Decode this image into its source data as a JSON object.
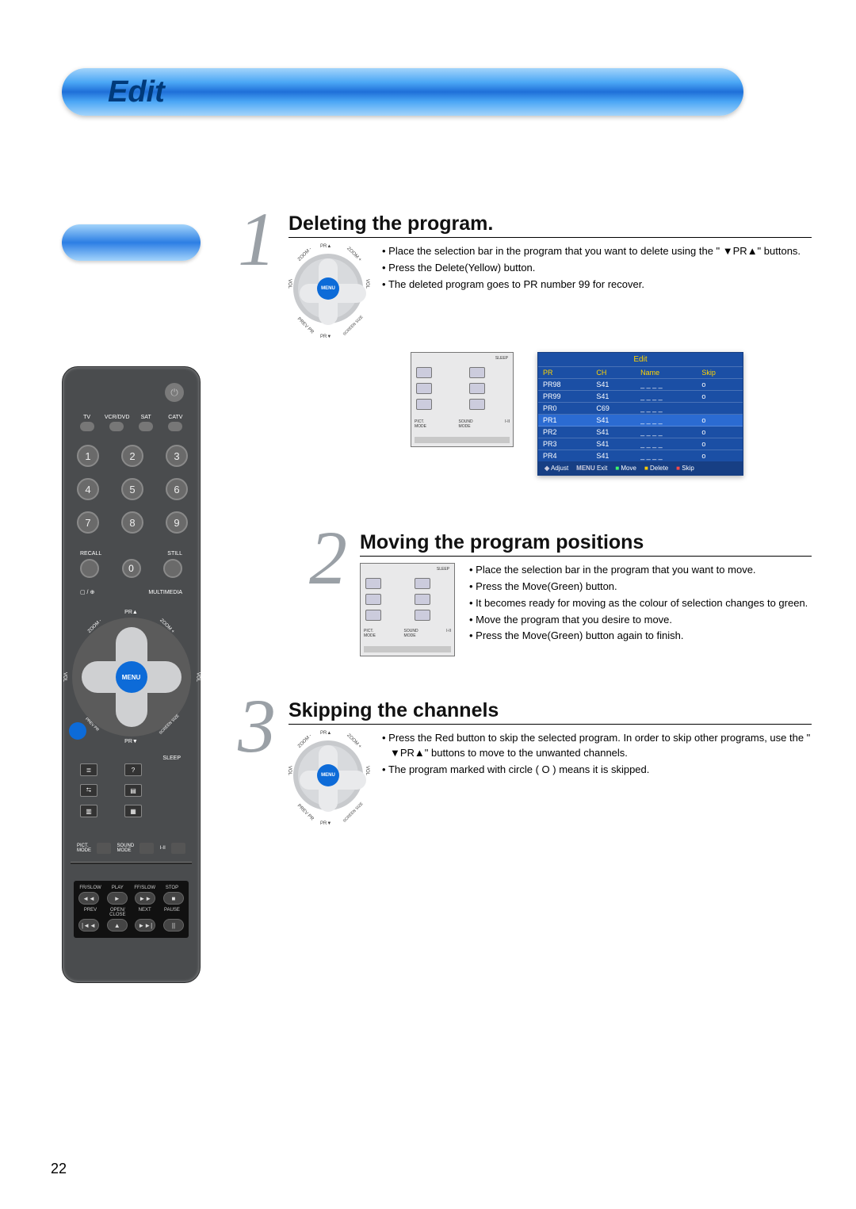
{
  "page_title": "Edit",
  "page_number": "22",
  "remote": {
    "sources": [
      "TV",
      "VCR/DVD",
      "SAT",
      "CATV"
    ],
    "numbers": [
      "1",
      "2",
      "3",
      "4",
      "5",
      "6",
      "7",
      "8",
      "9",
      "0"
    ],
    "recall": "RECALL",
    "still": "STILL",
    "multimedia": "MULTIMEDIA",
    "tv_av": "▢ / ⊕",
    "dpad": {
      "menu": "MENU",
      "pr_up": "PR▲",
      "pr_dn": "PR▼",
      "vol": "VOL",
      "zoom_minus": "ZOOM -",
      "zoom_plus": "ZOOM +",
      "prev_pr": "PREV PR",
      "screen_size": "SCREEN SIZE"
    },
    "sleep": "SLEEP",
    "modes": {
      "pict": "PICT.\nMODE",
      "sound": "SOUND\nMODE",
      "i_ii": "I-II"
    },
    "transport_labels_row1": [
      "FR/SLOW",
      "PLAY",
      "FF/SLOW",
      "STOP"
    ],
    "transport_labels_row2": [
      "PREV",
      "OPEN/\nCLOSE",
      "NEXT",
      "PAUSE"
    ],
    "transport_icons_row1": [
      "◄◄",
      "►",
      "►►",
      "■"
    ],
    "transport_icons_row2": [
      "|◄◄",
      "▲",
      "►►|",
      "||"
    ]
  },
  "steps": [
    {
      "num": "1",
      "title": "Deleting the program.",
      "bullets": [
        "Place the selection bar in the program that you want to delete using the \" ▼PR▲\" buttons.",
        "Press the Delete(Yellow) button.",
        "The deleted program goes to PR number 99 for recover."
      ]
    },
    {
      "num": "2",
      "title": "Moving the program positions",
      "bullets": [
        "Place the selection bar in the program that you want to move.",
        "Press the Move(Green) button.",
        "It becomes ready for moving as the colour of selection changes to green.",
        "Move the program that you desire to move.",
        "Press the Move(Green) button again to finish."
      ]
    },
    {
      "num": "3",
      "title": "Skipping the channels",
      "bullets": [
        "Press the Red button to skip the selected program. In order to skip other programs, use the \" ▼PR▲\" buttons to move to the unwanted channels.",
        "The program marked with circle ( O ) means it is skipped."
      ]
    }
  ],
  "osd": {
    "title": "Edit",
    "cols": [
      "PR",
      "CH",
      "Name",
      "Skip"
    ],
    "rows": [
      {
        "pr": "PR98",
        "ch": "S41",
        "name": "_ _ _ _",
        "skip": "o",
        "boxed": true
      },
      {
        "pr": "PR99",
        "ch": "S41",
        "name": "_ _ _ _",
        "skip": "o"
      },
      {
        "pr": "PR0",
        "ch": "C69",
        "name": "_ _ _ _",
        "skip": ""
      },
      {
        "pr": "PR1",
        "ch": "S41",
        "name": "_ _ _ _",
        "skip": "o",
        "hl": true
      },
      {
        "pr": "PR2",
        "ch": "S41",
        "name": "_ _ _ _",
        "skip": "o"
      },
      {
        "pr": "PR3",
        "ch": "S41",
        "name": "_ _ _ _",
        "skip": "o"
      },
      {
        "pr": "PR4",
        "ch": "S41",
        "name": "_ _ _ _",
        "skip": "o"
      }
    ],
    "legend": {
      "adjust": "Adjust",
      "exit": "Exit",
      "move": "Move",
      "delete": "Delete",
      "skip": "Skip",
      "menu_badge": "MENU"
    }
  },
  "mini": {
    "sleep": "SLEEP",
    "pict": "PICT.\nMODE",
    "sound": "SOUND\nMODE",
    "i_ii": "I-II"
  }
}
